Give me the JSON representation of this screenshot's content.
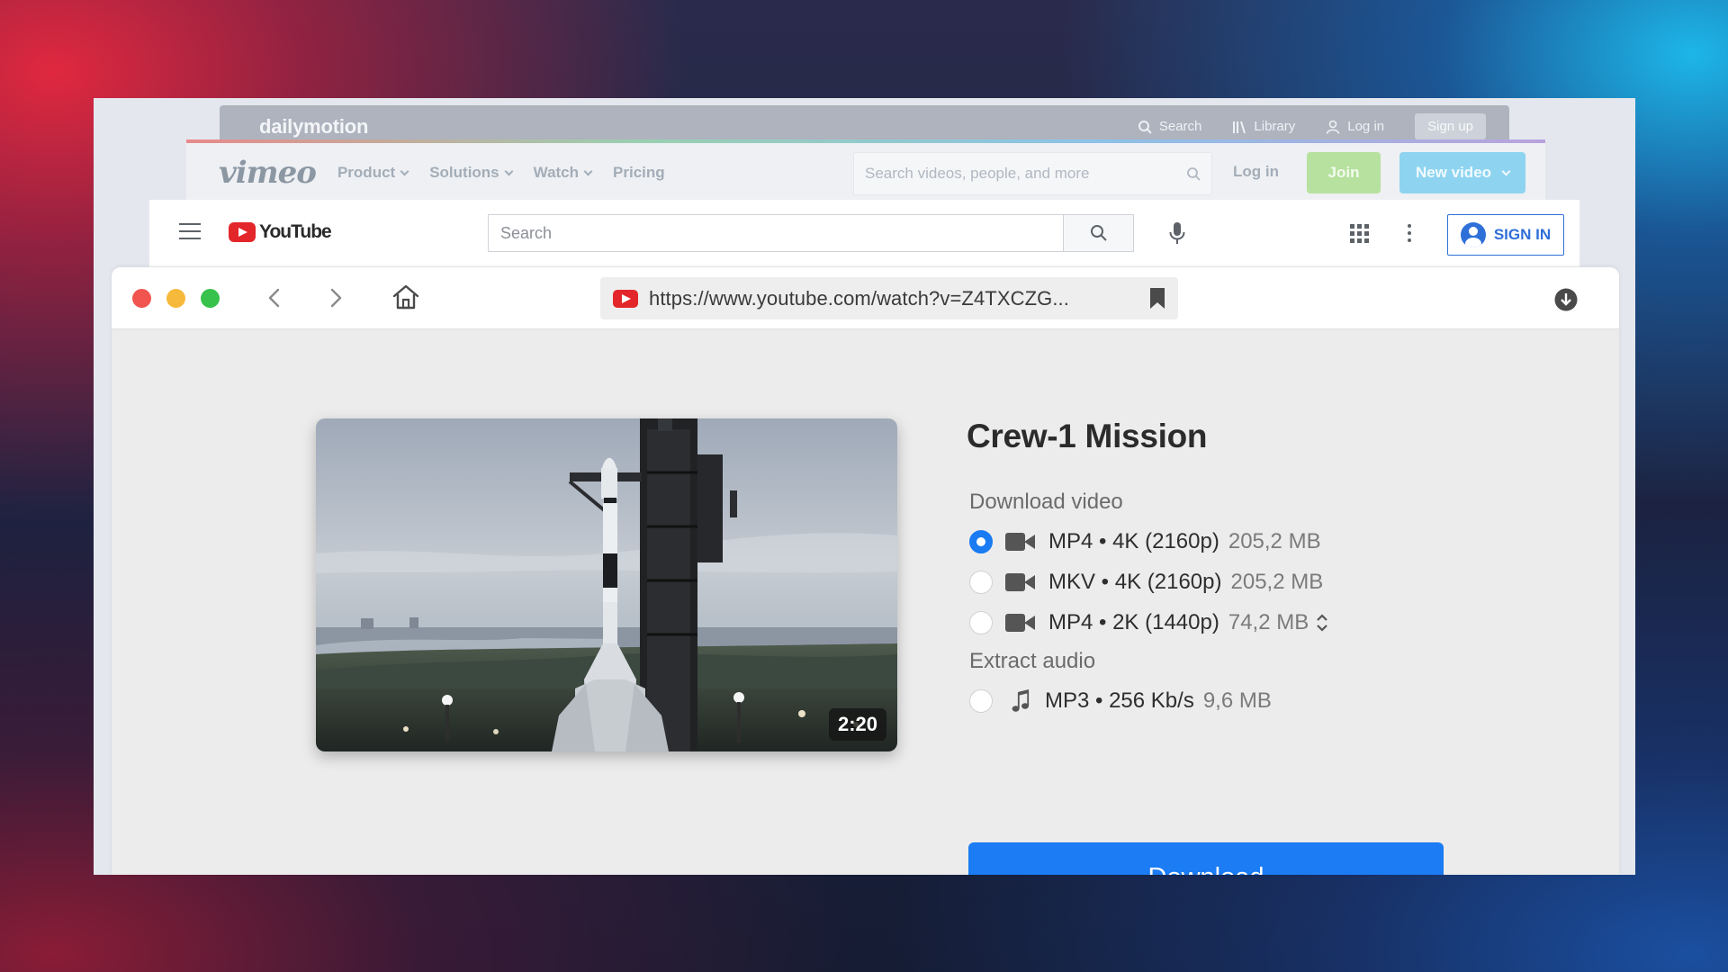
{
  "dailymotion": {
    "logo": "dailymotion",
    "search_label": "Search",
    "library_label": "Library",
    "login_label": "Log in",
    "signup_label": "Sign up"
  },
  "vimeo": {
    "logo": "vimeo",
    "nav": [
      {
        "label": "Product"
      },
      {
        "label": "Solutions"
      },
      {
        "label": "Watch"
      },
      {
        "label": "Pricing"
      }
    ],
    "search_placeholder": "Search videos, people, and more",
    "login_label": "Log in",
    "join_label": "Join",
    "new_video_label": "New video"
  },
  "youtube": {
    "logo_text": "YouTube",
    "search_placeholder": "Search",
    "signin_label": "SIGN IN"
  },
  "browser": {
    "url": "https://www.youtube.com/watch?v=Z4TXCZG..."
  },
  "video": {
    "title": "Crew-1 Mission",
    "duration": "2:20"
  },
  "download_video": {
    "label": "Download video",
    "options": [
      {
        "format": "MP4 • 4K (2160p)",
        "size": "205,2 MB",
        "selected": true
      },
      {
        "format": "MKV • 4K (2160p)",
        "size": "205,2 MB",
        "selected": false
      },
      {
        "format": "MP4 • 2K (1440p)",
        "size": "74,2 MB",
        "selected": false
      }
    ]
  },
  "extract_audio": {
    "label": "Extract audio",
    "options": [
      {
        "format": "MP3 • 256 Kb/s",
        "size": "9,6 MB",
        "selected": false
      }
    ]
  },
  "download_button": "Download",
  "colors": {
    "accent": "#1b7cf4",
    "youtube_red": "#e3262a",
    "vimeo_join": "#b6e19e",
    "vimeo_new_video": "#8ed4f0"
  }
}
